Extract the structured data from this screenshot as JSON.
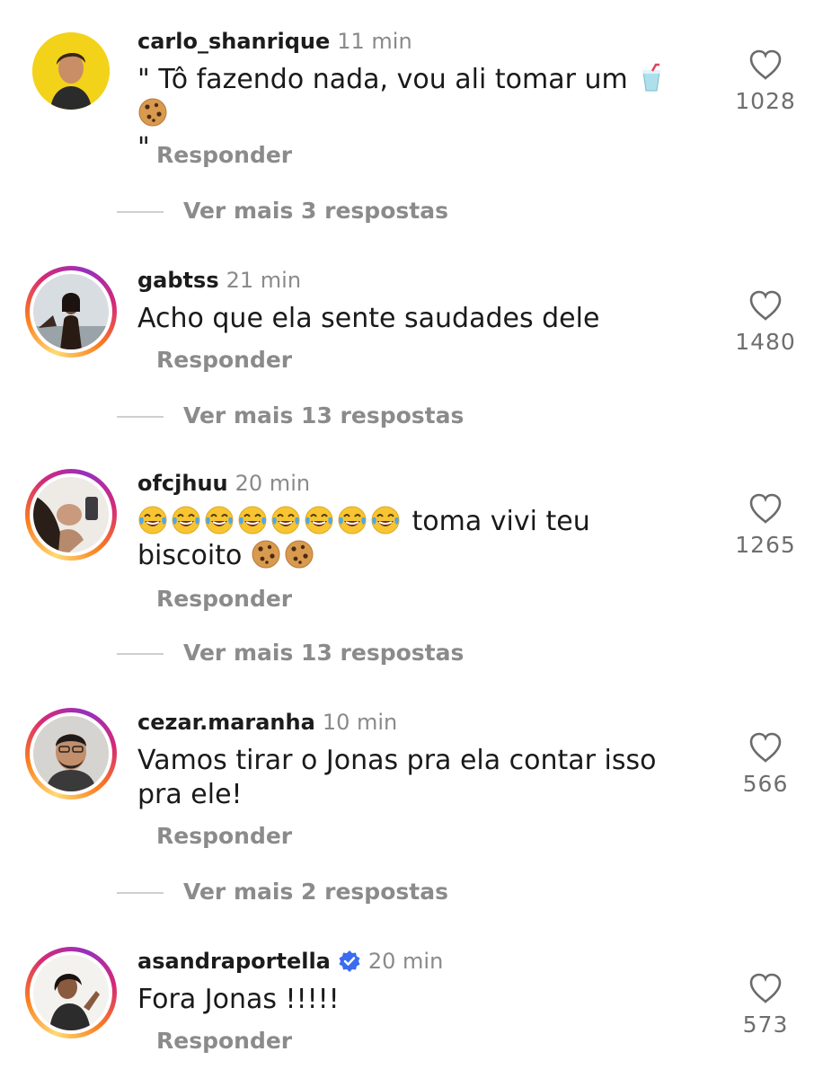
{
  "comments": [
    {
      "username": "carlo_shanrique",
      "time": "11 min",
      "text_line1": "\" Tô fazendo nada, vou ali tomar um",
      "text_line2": "\"",
      "reply": "Responder",
      "more_replies": "Ver mais 3 respostas",
      "likes": "1028",
      "verified": false
    },
    {
      "username": "gabtss",
      "time": "21 min",
      "text": "Acho que ela sente saudades dele",
      "reply": "Responder",
      "more_replies": "Ver mais 13 respostas",
      "likes": "1480"
    },
    {
      "username": "ofcjhuu",
      "time": "20 min",
      "text_line1_after_emoji": "toma vivi teu",
      "text_line2": "biscoito",
      "reply": "Responder",
      "more_replies": "Ver mais 13 respostas",
      "likes": "1265"
    },
    {
      "username": "cezar.maranha",
      "time": "10 min",
      "text_line1": "Vamos tirar o Jonas pra ela contar isso",
      "text_line2": "pra ele!",
      "reply": "Responder",
      "more_replies": "Ver mais 2 respostas",
      "likes": "566"
    },
    {
      "username": "asandraportella",
      "time": "20 min",
      "text": "Fora Jonas !!!!!",
      "reply": "Responder",
      "likes": "573",
      "verified": true
    }
  ],
  "icons": {
    "like": "heart-outline-icon",
    "verified": "verified-badge-icon",
    "emoji_cup": "cup-with-straw-emoji",
    "emoji_cookie": "cookie-emoji",
    "emoji_laugh": "face-with-tears-of-joy-emoji"
  },
  "colors": {
    "muted": "#8b8b8b",
    "verified_blue": "#3b6cf0",
    "story_ring": "#d62976"
  }
}
